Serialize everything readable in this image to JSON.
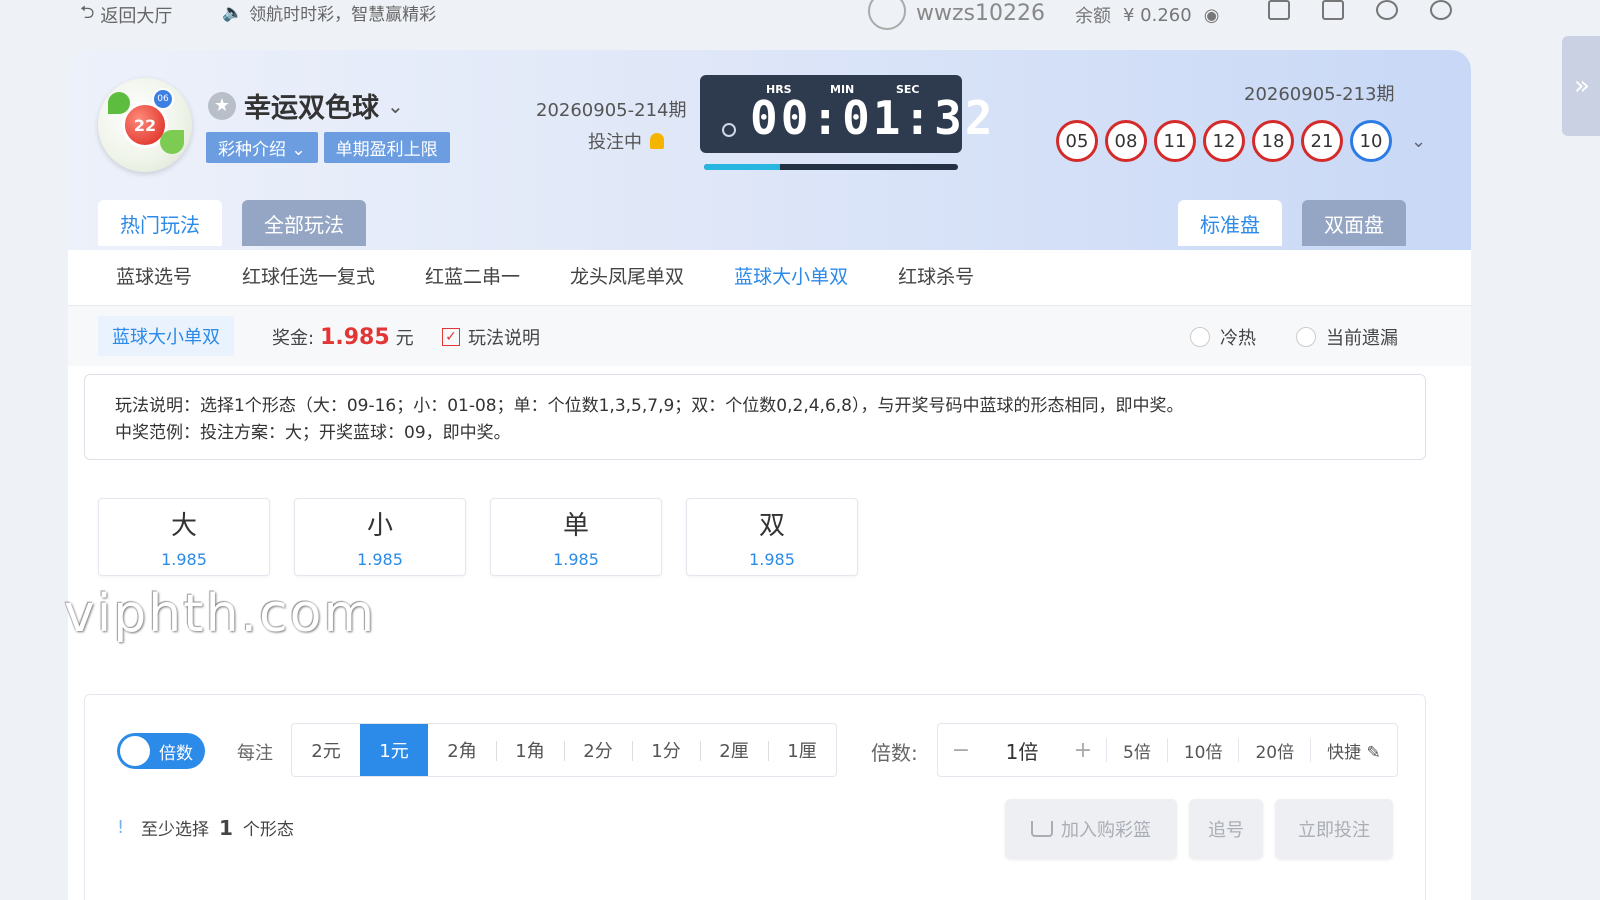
{
  "topbar": {
    "back_label": "返回大厅",
    "slogan": "领航时时彩，智慧赢精彩",
    "username": "wwzs10226",
    "balance_label": "余额",
    "balance_value": "¥ 0.260"
  },
  "lottery": {
    "name": "幸运双色球",
    "tags": [
      "彩种介绍 ⌄",
      "单期盈利上限"
    ],
    "current_issue": "20260905-214期",
    "bet_status": "投注中",
    "timer": {
      "hrs_label": "HRS",
      "min_label": "MIN",
      "sec_label": "SEC",
      "digits": "00:01:32",
      "progress": 0.3
    },
    "last_issue": "20260905-213期",
    "red_balls": [
      "05",
      "08",
      "11",
      "12",
      "18",
      "21"
    ],
    "blue_ball": "10",
    "logo_ball": "22",
    "logo_small_ball": "06"
  },
  "tabs": {
    "hot": "热门玩法",
    "all": "全部玩法",
    "standard": "标准盘",
    "double": "双面盘"
  },
  "subtabs": [
    "蓝球选号",
    "红球任选一复式",
    "红蓝二串一",
    "龙头凤尾单双",
    "蓝球大小单双",
    "红球杀号"
  ],
  "active_subtab_index": 4,
  "info": {
    "play_name": "蓝球大小单双",
    "prize_label": "奖金:",
    "prize_amount": "1.985",
    "prize_unit": "元",
    "rule_toggle": "玩法说明",
    "radio_hotcold": "冷热",
    "radio_missing": "当前遗漏"
  },
  "description": {
    "line1": "玩法说明：选择1个形态（大：09-16；小：01-08；单：个位数1,3,5,7,9；双：个位数0,2,4,6,8），与开奖号码中蓝球的形态相同，即中奖。",
    "line2": "中奖范例：投注方案：大；开奖蓝球：09，即中奖。"
  },
  "options": [
    {
      "name": "大",
      "odds": "1.985"
    },
    {
      "name": "小",
      "odds": "1.985"
    },
    {
      "name": "单",
      "odds": "1.985"
    },
    {
      "name": "双",
      "odds": "1.985"
    }
  ],
  "watermark": "viphth.com",
  "bet": {
    "toggle_label": "倍数",
    "unit_label": "每注",
    "units": [
      "2元",
      "1元",
      "2角",
      "1角",
      "2分",
      "1分",
      "2厘",
      "1厘"
    ],
    "selected_unit_index": 1,
    "multiplier_label": "倍数:",
    "minus": "−",
    "multiplier_value": "1倍",
    "plus": "+",
    "quick": [
      "5倍",
      "10倍",
      "20倍"
    ],
    "shortcut": "快捷 ✎",
    "hint_prefix": "至少选择",
    "hint_count": "1",
    "hint_suffix": "个形态",
    "add_cart": "加入购彩篮",
    "chase": "追号",
    "bet_now": "立即投注"
  },
  "colors": {
    "accent": "#2c8ae8",
    "red": "#d52a2a",
    "blue_ball": "#2c7be5",
    "prize": "#e23535"
  }
}
